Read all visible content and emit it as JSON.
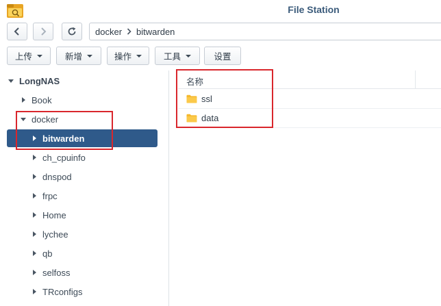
{
  "window": {
    "title": "File Station"
  },
  "nav": {
    "path": [
      "docker",
      "bitwarden"
    ]
  },
  "toolbar": {
    "upload_label": "上传",
    "new_label": "新增",
    "action_label": "操作",
    "tools_label": "工具",
    "settings_label": "设置"
  },
  "tree": {
    "root": "LongNAS",
    "items": [
      {
        "label": "Book"
      },
      {
        "label": "docker"
      },
      {
        "label": "bitwarden"
      },
      {
        "label": "ch_cpuinfo"
      },
      {
        "label": "dnspod"
      },
      {
        "label": "frpc"
      },
      {
        "label": "Home"
      },
      {
        "label": "lychee"
      },
      {
        "label": "qb"
      },
      {
        "label": "selfoss"
      },
      {
        "label": "TRconfigs"
      }
    ]
  },
  "list": {
    "column_name": "名称",
    "files": [
      {
        "name": "ssl",
        "type": "folder"
      },
      {
        "name": "data",
        "type": "folder"
      }
    ]
  },
  "colors": {
    "selected_bg": "#2f5a8a",
    "folder": "#f5b92e",
    "annotation": "#d9262c"
  }
}
